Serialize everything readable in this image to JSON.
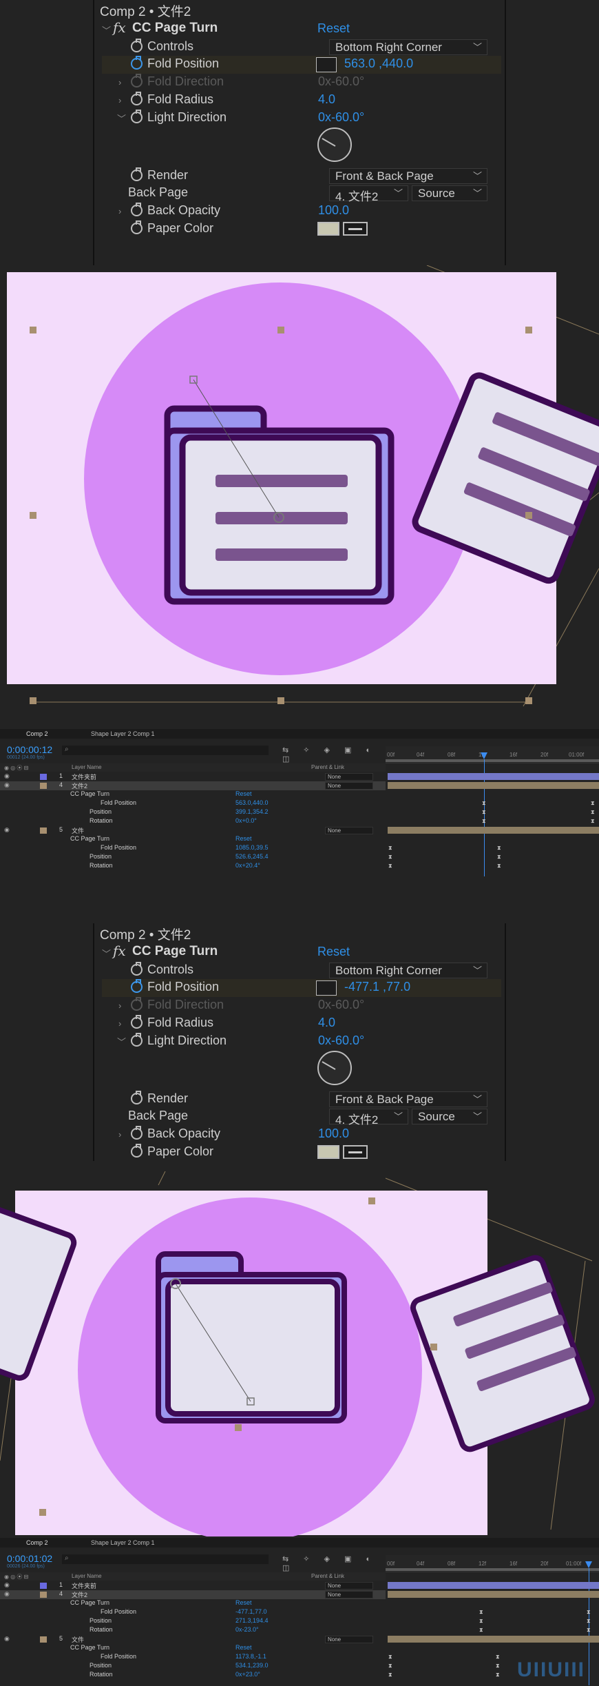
{
  "panel1": {
    "title": "Comp 2 • 文件2",
    "effect_name": "CC Page Turn",
    "reset": "Reset",
    "controls_label": "Controls",
    "controls_value": "Bottom Right Corner",
    "fold_position_label": "Fold Position",
    "fold_position_value": "563.0 ,440.0",
    "fold_direction_label": "Fold Direction",
    "fold_direction_value": "0x-60.0°",
    "fold_radius_label": "Fold Radius",
    "fold_radius_value": "4.0",
    "light_direction_label": "Light Direction",
    "light_direction_value": "0x-60.0°",
    "render_label": "Render",
    "render_value": "Front & Back Page",
    "back_page_label": "Back Page",
    "back_page_layer": "4. 文件2",
    "back_page_source": "Source",
    "back_opacity_label": "Back Opacity",
    "back_opacity_value": "100.0",
    "paper_color_label": "Paper Color"
  },
  "timeline1": {
    "tab1": "Comp 2",
    "tab2": "Shape Layer 2 Comp 1",
    "timecode": "0:00:00:12",
    "timecode_sub": "00012 (24.00 fps)",
    "col_layer_name": "Layer Name",
    "col_parent": "Parent & Link",
    "ruler": [
      "00f",
      "04f",
      "08f",
      "12f",
      "16f",
      "20f",
      "01:00f"
    ],
    "rows": [
      {
        "num": "1",
        "name": "文件夹前",
        "parent": "None"
      },
      {
        "num": "4",
        "name": "文件2",
        "parent": "None"
      },
      {
        "name": "CC Page Turn",
        "value": "Reset"
      },
      {
        "name": "Fold Position",
        "value": "563.0,440.0"
      },
      {
        "name": "Position",
        "value": "399.1,354.2"
      },
      {
        "name": "Rotation",
        "value": "0x+0.0°"
      },
      {
        "num": "5",
        "name": "文件",
        "parent": "None"
      },
      {
        "name": "CC Page Turn",
        "value": "Reset"
      },
      {
        "name": "Fold Position",
        "value": "1085.0,39.5"
      },
      {
        "name": "Position",
        "value": "526.6,245.4"
      },
      {
        "name": "Rotation",
        "value": "0x+20.4°"
      }
    ]
  },
  "panel2": {
    "title": "Comp 2 • 文件2",
    "effect_name": "CC Page Turn",
    "reset": "Reset",
    "controls_label": "Controls",
    "controls_value": "Bottom Right Corner",
    "fold_position_label": "Fold Position",
    "fold_position_value": "-477.1 ,77.0",
    "fold_direction_label": "Fold Direction",
    "fold_direction_value": "0x-60.0°",
    "fold_radius_label": "Fold Radius",
    "fold_radius_value": "4.0",
    "light_direction_label": "Light Direction",
    "light_direction_value": "0x-60.0°",
    "render_label": "Render",
    "render_value": "Front & Back Page",
    "back_page_label": "Back Page",
    "back_page_layer": "4. 文件2",
    "back_page_source": "Source",
    "back_opacity_label": "Back Opacity",
    "back_opacity_value": "100.0",
    "paper_color_label": "Paper Color"
  },
  "timeline2": {
    "tab1": "Comp 2",
    "tab2": "Shape Layer 2 Comp 1",
    "timecode": "0:00:01:02",
    "timecode_sub": "00026 (24.00 fps)",
    "col_layer_name": "Layer Name",
    "col_parent": "Parent & Link",
    "ruler": [
      "00f",
      "04f",
      "08f",
      "12f",
      "16f",
      "20f",
      "01:00f"
    ],
    "rows": [
      {
        "num": "1",
        "name": "文件夹前",
        "parent": "None"
      },
      {
        "num": "4",
        "name": "文件2",
        "parent": "None"
      },
      {
        "name": "CC Page Turn",
        "value": "Reset"
      },
      {
        "name": "Fold Position",
        "value": "-477.1,77.0"
      },
      {
        "name": "Position",
        "value": "271.3,194.4"
      },
      {
        "name": "Rotation",
        "value": "0x-23.0°"
      },
      {
        "num": "5",
        "name": "文件",
        "parent": "None"
      },
      {
        "name": "CC Page Turn",
        "value": "Reset"
      },
      {
        "name": "Fold Position",
        "value": "1173.8,-1.1"
      },
      {
        "name": "Position",
        "value": "534.1,239.0"
      },
      {
        "name": "Rotation",
        "value": "0x+23.0°"
      }
    ]
  },
  "watermark": "UIIUIII",
  "colors": {
    "accent": "#2f8fe6",
    "canvas_bg": "#f3dcfb",
    "circle": "#d68af7",
    "outline": "#3e0a55",
    "folder_back": "#9c96ef",
    "paper": "#e4e2ef",
    "stripe": "#7a548e"
  }
}
